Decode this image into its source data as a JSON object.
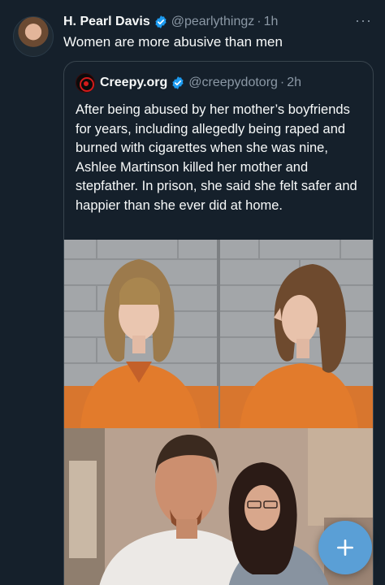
{
  "tweet": {
    "author": {
      "display_name": "H. Pearl Davis",
      "handle": "@pearlythingz",
      "time": "1h",
      "verified": true
    },
    "text": "Women are more abusive than men",
    "more_icon": "more-horizontal-icon"
  },
  "quote": {
    "author": {
      "display_name": "Creepy.org",
      "handle": "@creepydotorg",
      "time": "2h",
      "verified": true
    },
    "text": "After being abused by her mother’s boyfriends for years, including allegedly being raped and burned with cigarettes when she was nine, Ashlee Martinson killed her mother and stepfather. In prison, she said she felt safer and happier than she ever did at home."
  },
  "fab": {
    "icon": "plus-icon"
  },
  "colors": {
    "background": "#15202b",
    "text": "#f7f9f9",
    "muted": "#8b98a5",
    "verified": "#1d9bf0",
    "fab": "#5a9fd6",
    "border": "#38444d"
  }
}
